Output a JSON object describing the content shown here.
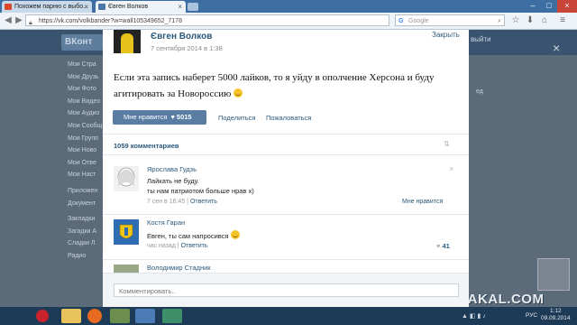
{
  "browser": {
    "tabs": [
      {
        "title": "Похожем парню с выбо...",
        "close": "×"
      },
      {
        "title": "Євген Волков",
        "close": "×"
      }
    ],
    "new_tab": "+",
    "window_controls": [
      "–",
      "□",
      "×"
    ],
    "url": "https://vk.com/volkbander?w=wall105349652_7178",
    "search_engine": "G",
    "search_placeholder": "Google"
  },
  "background_page": {
    "logo": "ВКонт",
    "logout": "выйти",
    "left_menu": [
      "Мои Стра",
      "Мои Друзь",
      "Мои Фото",
      "Мои Видео",
      "Мои Аудио",
      "Мои Сообщ",
      "Мои Групп",
      "Мои Ново",
      "Мои Отве",
      "Мои Наст",
      "Приложен",
      "Документ",
      "Закладки",
      "Загадки А",
      "Сладки Л",
      "Радио"
    ],
    "right_snippet": "ед",
    "close_icon": "×"
  },
  "post": {
    "author": "Євген Волков",
    "date": "7 сентября 2014 в 1:38",
    "close_label": "Закрыть",
    "text": "Если эта запись наберет 5000 лайков, то я уйду в ополчение Херсона и буду агитировать за Новороссию",
    "like_label": "Мне нравится",
    "like_count": "5015",
    "share_label": "Поделиться",
    "report_label": "Пожаловаться",
    "comments_count": "1059 комментариев"
  },
  "comments": [
    {
      "name": "Ярослава Гудзь",
      "lines": [
        "Лайкать не буду.",
        "ты нам патриотом больше нрав х)"
      ],
      "time": "7 сен в 16:45",
      "reply": "Ответить",
      "right": "Мне нравится"
    },
    {
      "name": "Костя Гаран",
      "lines": [
        "Евген, ты сам напросився"
      ],
      "time": "час назад",
      "reply": "Ответить",
      "likes": "41"
    },
    {
      "name": "Володимир Стадник"
    }
  ],
  "compose_placeholder": "Комментировать..",
  "watermark": "YAPLAKAL.COM",
  "taskbar": {
    "lang": "РУС",
    "time": "1:12",
    "date": "09.09.2014"
  },
  "colors": {
    "vk_blue": "#597da3",
    "link": "#2b587a",
    "overlay": "#5b6b79",
    "taskbar": "#1d3a57"
  }
}
